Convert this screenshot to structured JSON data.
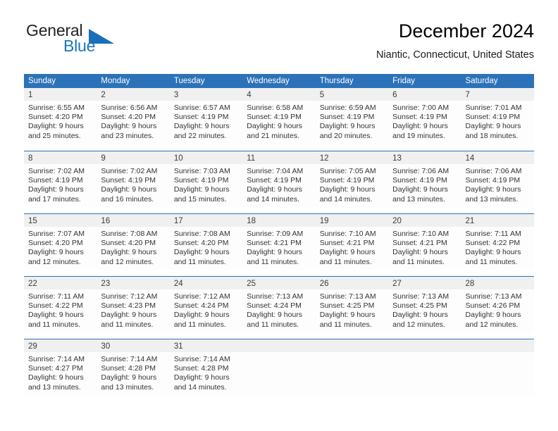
{
  "brand": {
    "name_part1": "General",
    "name_part2": "Blue",
    "accent_color": "#1b75bb",
    "triangle_color": "#1b6fb8"
  },
  "header": {
    "title": "December 2024",
    "subtitle": "Niantic, Connecticut, United States",
    "header_bg": "#2c72b8",
    "day_band_bg": "#f0f0f0"
  },
  "weekdays": [
    "Sunday",
    "Monday",
    "Tuesday",
    "Wednesday",
    "Thursday",
    "Friday",
    "Saturday"
  ],
  "weeks": [
    [
      {
        "day": "1",
        "sunrise": "Sunrise: 6:55 AM",
        "sunset": "Sunset: 4:20 PM",
        "daylight1": "Daylight: 9 hours",
        "daylight2": "and 25 minutes."
      },
      {
        "day": "2",
        "sunrise": "Sunrise: 6:56 AM",
        "sunset": "Sunset: 4:20 PM",
        "daylight1": "Daylight: 9 hours",
        "daylight2": "and 23 minutes."
      },
      {
        "day": "3",
        "sunrise": "Sunrise: 6:57 AM",
        "sunset": "Sunset: 4:19 PM",
        "daylight1": "Daylight: 9 hours",
        "daylight2": "and 22 minutes."
      },
      {
        "day": "4",
        "sunrise": "Sunrise: 6:58 AM",
        "sunset": "Sunset: 4:19 PM",
        "daylight1": "Daylight: 9 hours",
        "daylight2": "and 21 minutes."
      },
      {
        "day": "5",
        "sunrise": "Sunrise: 6:59 AM",
        "sunset": "Sunset: 4:19 PM",
        "daylight1": "Daylight: 9 hours",
        "daylight2": "and 20 minutes."
      },
      {
        "day": "6",
        "sunrise": "Sunrise: 7:00 AM",
        "sunset": "Sunset: 4:19 PM",
        "daylight1": "Daylight: 9 hours",
        "daylight2": "and 19 minutes."
      },
      {
        "day": "7",
        "sunrise": "Sunrise: 7:01 AM",
        "sunset": "Sunset: 4:19 PM",
        "daylight1": "Daylight: 9 hours",
        "daylight2": "and 18 minutes."
      }
    ],
    [
      {
        "day": "8",
        "sunrise": "Sunrise: 7:02 AM",
        "sunset": "Sunset: 4:19 PM",
        "daylight1": "Daylight: 9 hours",
        "daylight2": "and 17 minutes."
      },
      {
        "day": "9",
        "sunrise": "Sunrise: 7:02 AM",
        "sunset": "Sunset: 4:19 PM",
        "daylight1": "Daylight: 9 hours",
        "daylight2": "and 16 minutes."
      },
      {
        "day": "10",
        "sunrise": "Sunrise: 7:03 AM",
        "sunset": "Sunset: 4:19 PM",
        "daylight1": "Daylight: 9 hours",
        "daylight2": "and 15 minutes."
      },
      {
        "day": "11",
        "sunrise": "Sunrise: 7:04 AM",
        "sunset": "Sunset: 4:19 PM",
        "daylight1": "Daylight: 9 hours",
        "daylight2": "and 14 minutes."
      },
      {
        "day": "12",
        "sunrise": "Sunrise: 7:05 AM",
        "sunset": "Sunset: 4:19 PM",
        "daylight1": "Daylight: 9 hours",
        "daylight2": "and 14 minutes."
      },
      {
        "day": "13",
        "sunrise": "Sunrise: 7:06 AM",
        "sunset": "Sunset: 4:19 PM",
        "daylight1": "Daylight: 9 hours",
        "daylight2": "and 13 minutes."
      },
      {
        "day": "14",
        "sunrise": "Sunrise: 7:06 AM",
        "sunset": "Sunset: 4:19 PM",
        "daylight1": "Daylight: 9 hours",
        "daylight2": "and 13 minutes."
      }
    ],
    [
      {
        "day": "15",
        "sunrise": "Sunrise: 7:07 AM",
        "sunset": "Sunset: 4:20 PM",
        "daylight1": "Daylight: 9 hours",
        "daylight2": "and 12 minutes."
      },
      {
        "day": "16",
        "sunrise": "Sunrise: 7:08 AM",
        "sunset": "Sunset: 4:20 PM",
        "daylight1": "Daylight: 9 hours",
        "daylight2": "and 12 minutes."
      },
      {
        "day": "17",
        "sunrise": "Sunrise: 7:08 AM",
        "sunset": "Sunset: 4:20 PM",
        "daylight1": "Daylight: 9 hours",
        "daylight2": "and 11 minutes."
      },
      {
        "day": "18",
        "sunrise": "Sunrise: 7:09 AM",
        "sunset": "Sunset: 4:21 PM",
        "daylight1": "Daylight: 9 hours",
        "daylight2": "and 11 minutes."
      },
      {
        "day": "19",
        "sunrise": "Sunrise: 7:10 AM",
        "sunset": "Sunset: 4:21 PM",
        "daylight1": "Daylight: 9 hours",
        "daylight2": "and 11 minutes."
      },
      {
        "day": "20",
        "sunrise": "Sunrise: 7:10 AM",
        "sunset": "Sunset: 4:21 PM",
        "daylight1": "Daylight: 9 hours",
        "daylight2": "and 11 minutes."
      },
      {
        "day": "21",
        "sunrise": "Sunrise: 7:11 AM",
        "sunset": "Sunset: 4:22 PM",
        "daylight1": "Daylight: 9 hours",
        "daylight2": "and 11 minutes."
      }
    ],
    [
      {
        "day": "22",
        "sunrise": "Sunrise: 7:11 AM",
        "sunset": "Sunset: 4:22 PM",
        "daylight1": "Daylight: 9 hours",
        "daylight2": "and 11 minutes."
      },
      {
        "day": "23",
        "sunrise": "Sunrise: 7:12 AM",
        "sunset": "Sunset: 4:23 PM",
        "daylight1": "Daylight: 9 hours",
        "daylight2": "and 11 minutes."
      },
      {
        "day": "24",
        "sunrise": "Sunrise: 7:12 AM",
        "sunset": "Sunset: 4:24 PM",
        "daylight1": "Daylight: 9 hours",
        "daylight2": "and 11 minutes."
      },
      {
        "day": "25",
        "sunrise": "Sunrise: 7:13 AM",
        "sunset": "Sunset: 4:24 PM",
        "daylight1": "Daylight: 9 hours",
        "daylight2": "and 11 minutes."
      },
      {
        "day": "26",
        "sunrise": "Sunrise: 7:13 AM",
        "sunset": "Sunset: 4:25 PM",
        "daylight1": "Daylight: 9 hours",
        "daylight2": "and 11 minutes."
      },
      {
        "day": "27",
        "sunrise": "Sunrise: 7:13 AM",
        "sunset": "Sunset: 4:25 PM",
        "daylight1": "Daylight: 9 hours",
        "daylight2": "and 12 minutes."
      },
      {
        "day": "28",
        "sunrise": "Sunrise: 7:13 AM",
        "sunset": "Sunset: 4:26 PM",
        "daylight1": "Daylight: 9 hours",
        "daylight2": "and 12 minutes."
      }
    ],
    [
      {
        "day": "29",
        "sunrise": "Sunrise: 7:14 AM",
        "sunset": "Sunset: 4:27 PM",
        "daylight1": "Daylight: 9 hours",
        "daylight2": "and 13 minutes."
      },
      {
        "day": "30",
        "sunrise": "Sunrise: 7:14 AM",
        "sunset": "Sunset: 4:28 PM",
        "daylight1": "Daylight: 9 hours",
        "daylight2": "and 13 minutes."
      },
      {
        "day": "31",
        "sunrise": "Sunrise: 7:14 AM",
        "sunset": "Sunset: 4:28 PM",
        "daylight1": "Daylight: 9 hours",
        "daylight2": "and 14 minutes."
      },
      {
        "day": "",
        "sunrise": "",
        "sunset": "",
        "daylight1": "",
        "daylight2": ""
      },
      {
        "day": "",
        "sunrise": "",
        "sunset": "",
        "daylight1": "",
        "daylight2": ""
      },
      {
        "day": "",
        "sunrise": "",
        "sunset": "",
        "daylight1": "",
        "daylight2": ""
      },
      {
        "day": "",
        "sunrise": "",
        "sunset": "",
        "daylight1": "",
        "daylight2": ""
      }
    ]
  ]
}
